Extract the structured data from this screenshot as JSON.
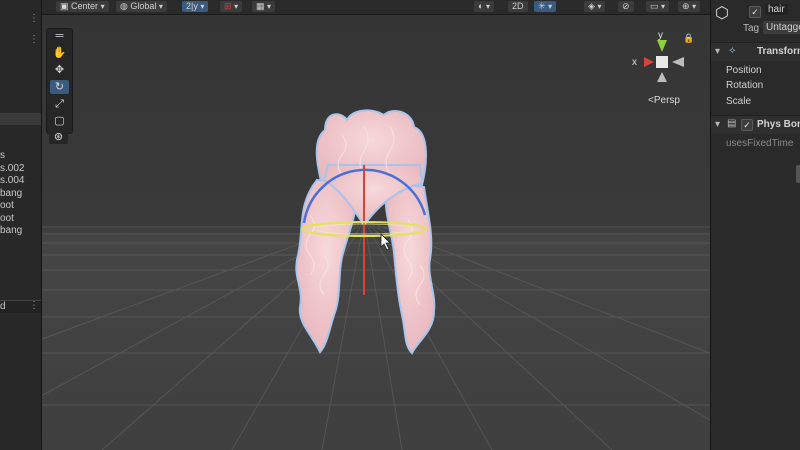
{
  "toolbar": {
    "pivot_mode": "Center",
    "pivot_rotation": "Global",
    "snap_value": "2|y",
    "scene_2d": "2D"
  },
  "hierarchy": {
    "items": [
      "s",
      "s.002",
      "s.004",
      "bang",
      "oot",
      "oot",
      "bang"
    ],
    "bottom_label": "d"
  },
  "scene": {
    "projection_label": "<Persp",
    "axis_labels": {
      "x": "x",
      "y": "y"
    }
  },
  "inspector": {
    "object_name": "hair",
    "tag_label": "Tag",
    "tag_value": "Untagged",
    "transform": {
      "title": "Transform",
      "fields": [
        "Position",
        "Rotation",
        "Scale"
      ]
    },
    "physbone": {
      "title": "Phys Bone",
      "field": "usesFixedTime"
    }
  },
  "colors": {
    "selection_blue": "#3a5b7e",
    "hair_pink": "#f2c9cd",
    "gizmo_x": "#d9423b",
    "gizmo_y": "#8cd13b",
    "gizmo_z": "#4a6fd6"
  }
}
